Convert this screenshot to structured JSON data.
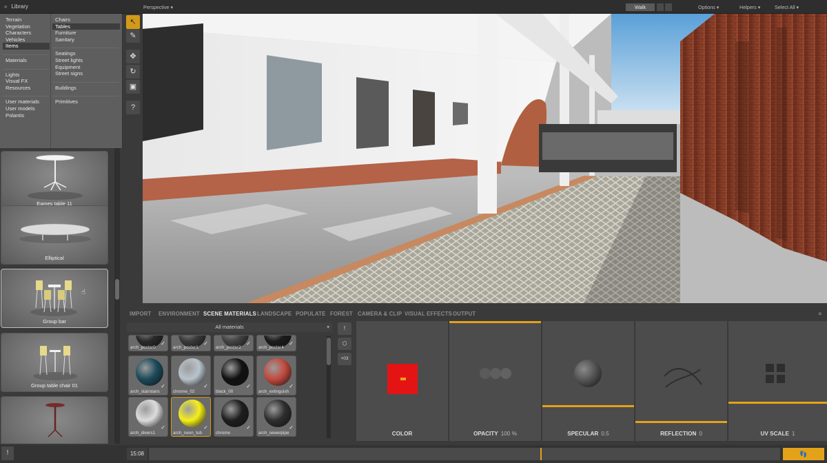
{
  "library": {
    "title": "Library",
    "categories_main": [
      "Terrain",
      "Vegetation",
      "Characters",
      "Vehicles",
      "Items"
    ],
    "categories_mid": [
      "Materials"
    ],
    "categories_lights": [
      "Lights",
      "Visual FX",
      "Resources"
    ],
    "categories_user": [
      "User materials",
      "User models",
      "Polantis"
    ],
    "sub_group1": [
      "Chairs",
      "Tables",
      "Furniture",
      "Sanitary"
    ],
    "sub_group2": [
      "Seatings",
      "Street lights",
      "Equipment",
      "Street signs"
    ],
    "sub_group3": [
      "Buildings"
    ],
    "sub_group4": [
      "Primitives"
    ],
    "selected_category": "Items",
    "selected_sub": "Tables",
    "items": [
      {
        "label": "Eames table 11"
      },
      {
        "label": "Elliptical"
      },
      {
        "label": "Group bar"
      },
      {
        "label": "Group table chair 01"
      },
      {
        "label": ""
      }
    ]
  },
  "topbar": {
    "view": "Perspective ▾",
    "walk": "Walk",
    "options": "Options ▾",
    "helpers": "Helpers ▾",
    "select_all": "Select All ▾"
  },
  "tools": [
    {
      "name": "select-tool-icon",
      "glyph": "↖"
    },
    {
      "name": "paint-tool-icon",
      "glyph": "✎"
    },
    {
      "name": "move-tool-icon",
      "glyph": "✥"
    },
    {
      "name": "rotate-tool-icon",
      "glyph": "↻"
    },
    {
      "name": "scale-tool-icon",
      "glyph": "▣"
    },
    {
      "name": "help-icon",
      "glyph": "?"
    }
  ],
  "tabs": [
    "IMPORT",
    "ENVIRONMENT",
    "SCENE MATERIALS",
    "LANDSCAPE",
    "POPULATE",
    "FOREST",
    "CAMERA & CLIP",
    "VISUAL EFFECTS",
    "OUTPUT"
  ],
  "active_tab": "SCENE MATERIALS",
  "materials": {
    "filter": "All materials",
    "items": [
      {
        "name": "arch_poster0",
        "color": "#2a2a2a"
      },
      {
        "name": "arch_poster1",
        "color": "#3a3a3a"
      },
      {
        "name": "arch_poster2",
        "color": "#444444"
      },
      {
        "name": "arch_poster4",
        "color": "#1c1c1c"
      },
      {
        "name": "arch_stairstairs",
        "color": "#1b4a5a"
      },
      {
        "name": "chrome_02",
        "color": "#b9c4cc"
      },
      {
        "name": "black_00",
        "color": "#111111"
      },
      {
        "name": "arch_extinguish",
        "color": "#c24a3e"
      },
      {
        "name": "arch_divers1",
        "color": "#dcdcdc"
      },
      {
        "name": "arch_neon_tub",
        "color": "#f6ef1a"
      },
      {
        "name": "chrome",
        "color": "#1e1e1e"
      },
      {
        "name": "arch_sewerpipe",
        "color": "#2e2e2e"
      }
    ]
  },
  "mat_tools": [
    "!",
    "⬡",
    "+03"
  ],
  "properties": [
    {
      "label": "COLOR",
      "value": "",
      "swatch": "#e41414"
    },
    {
      "label": "OPACITY",
      "value": "100 %"
    },
    {
      "label": "SPECULAR",
      "value": "0.5"
    },
    {
      "label": "REFLECTION",
      "value": "0"
    },
    {
      "label": "UV SCALE",
      "value": "1"
    }
  ],
  "timeline": {
    "time": "15:08",
    "position": 0.62
  },
  "colors": {
    "accent": "#e4a21a",
    "panel": "#4c4c4c",
    "background": "#3a3a3a"
  }
}
